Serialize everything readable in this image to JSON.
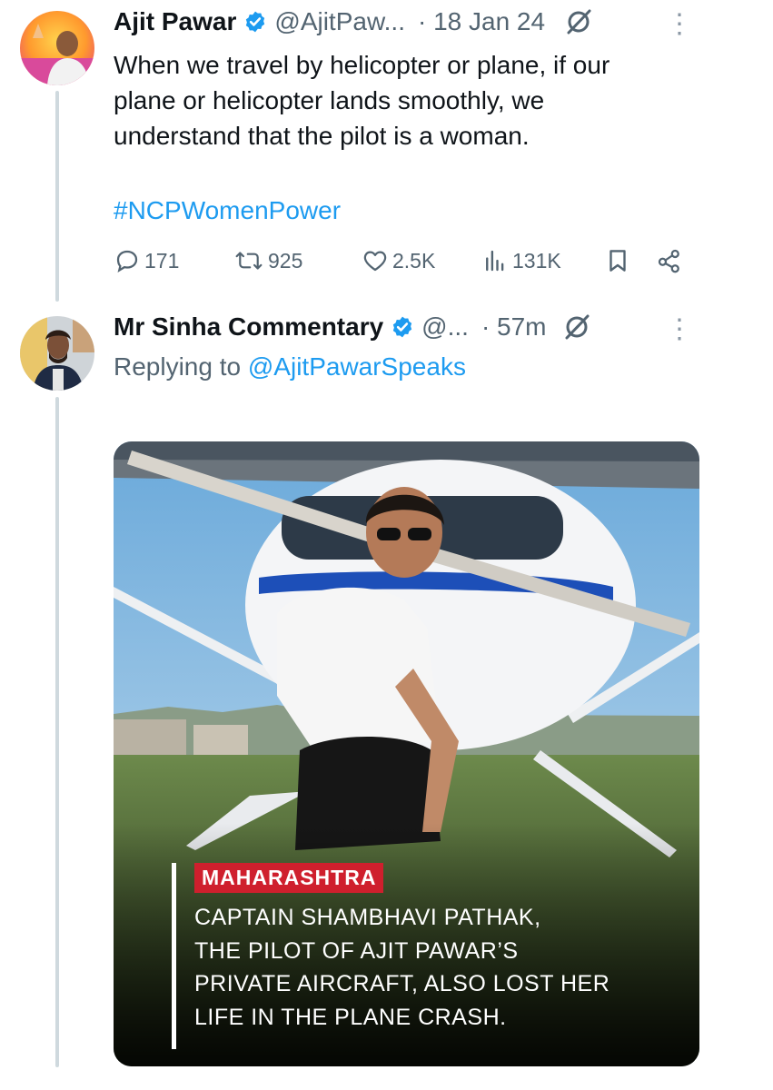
{
  "tweet1": {
    "author_name": "Ajit Pawar",
    "handle": "@AjitPaw...",
    "date": "· 18 Jan 24",
    "more": "⋮",
    "text_lines": [
      "When we travel by helicopter or plane, if our",
      "plane or helicopter lands smoothly, we",
      "understand that the pilot is a woman."
    ],
    "hashtag": "#NCPWomenPower",
    "stats": {
      "replies": "171",
      "reposts": "925",
      "likes": "2.5K",
      "views": "131K"
    }
  },
  "tweet2": {
    "author_name": "Mr Sinha Commentary",
    "handle": "@...",
    "time": "· 57m",
    "more": "⋮",
    "replying_prefix": "Replying to ",
    "replying_handle": "@AjitPawarSpeaks",
    "media": {
      "tag": "MAHARASHTRA",
      "headline_lines": [
        "CAPTAIN SHAMBHAVI PATHAK,",
        "THE PILOT OF AJIT PAWAR’S",
        "PRIVATE AIRCRAFT, ALSO LOST HER",
        "LIFE IN THE PLANE CRASH."
      ]
    }
  },
  "colors": {
    "accent": "#1d9bf0",
    "muted": "#536471",
    "tag_red": "#cf1f2d",
    "thread_line": "#cfd9de"
  },
  "icons": {
    "verified": "verified-badge-icon",
    "grok": "grok-icon",
    "reply": "reply-icon",
    "repost": "repost-icon",
    "like": "heart-icon",
    "views": "views-icon",
    "bookmark": "bookmark-icon",
    "share": "share-icon"
  }
}
